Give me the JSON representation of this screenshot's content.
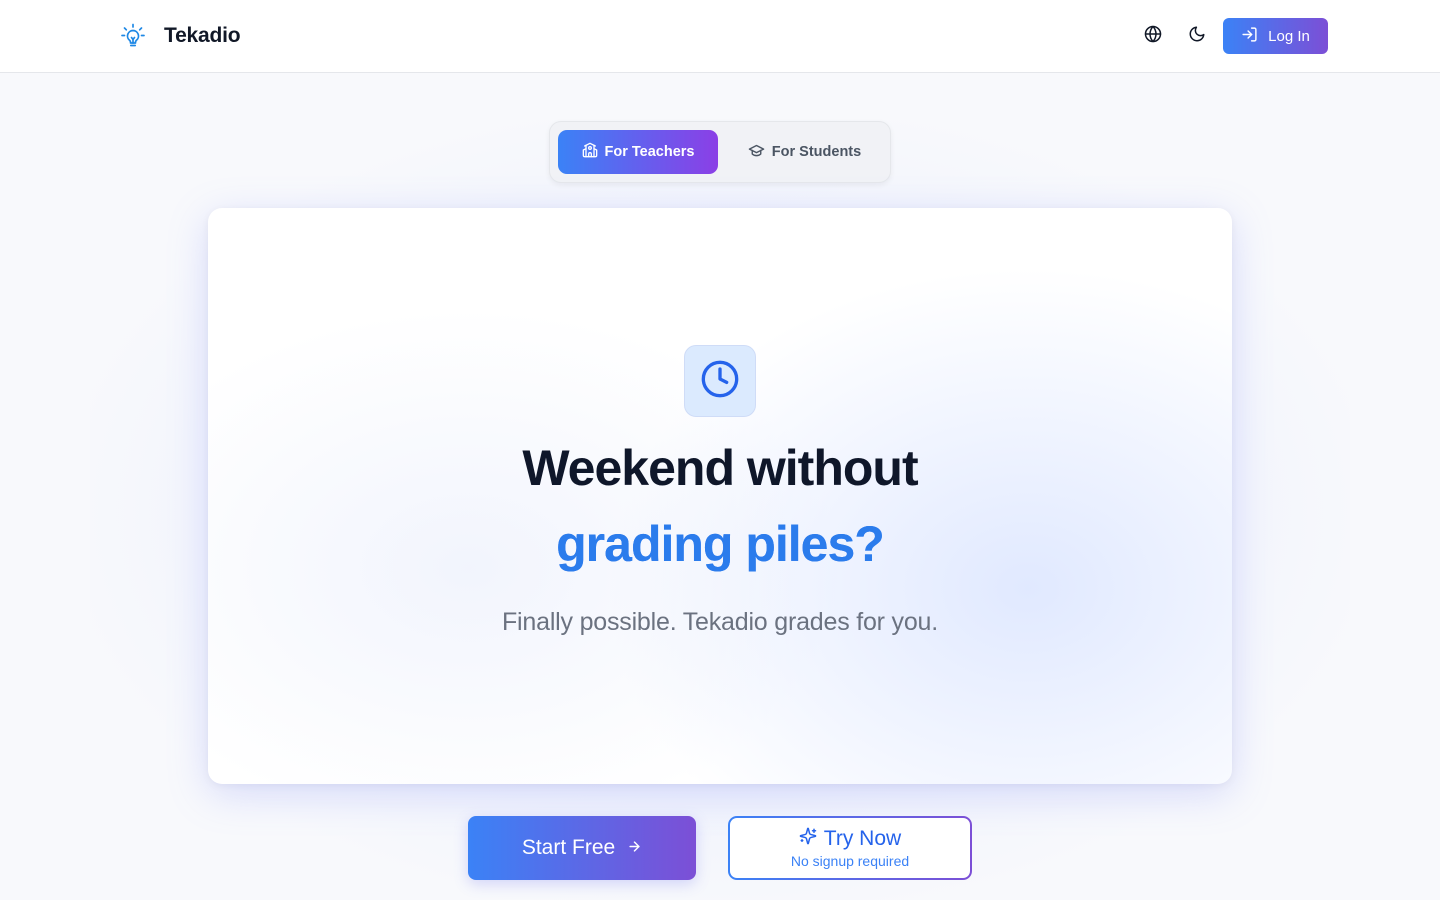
{
  "header": {
    "brand_name": "Tekadio",
    "brand_icon": "lightbulb-icon",
    "language_icon": "globe-icon",
    "theme_icon": "moon-icon",
    "login_label": "Log In",
    "login_icon": "log-in-icon"
  },
  "tabs": [
    {
      "label": "For Teachers",
      "icon": "school-icon",
      "active": true
    },
    {
      "label": "For Students",
      "icon": "graduation-cap-icon",
      "active": false
    }
  ],
  "hero": {
    "icon": "clock-icon",
    "headline_line1": "Weekend without",
    "headline_line2": "grading piles?",
    "subheadline": "Finally possible. Tekadio grades for you."
  },
  "cta": {
    "start_label": "Start Free",
    "start_icon": "arrow-right-icon",
    "try_label": "Try Now",
    "try_icon": "sparkles-icon",
    "try_sublabel": "No signup required"
  },
  "colors": {
    "accent_start": "#3b82f6",
    "accent_end": "#7c4fd6",
    "headline_highlight": "#2b7cec",
    "brand_icon": "#1e88e5"
  }
}
